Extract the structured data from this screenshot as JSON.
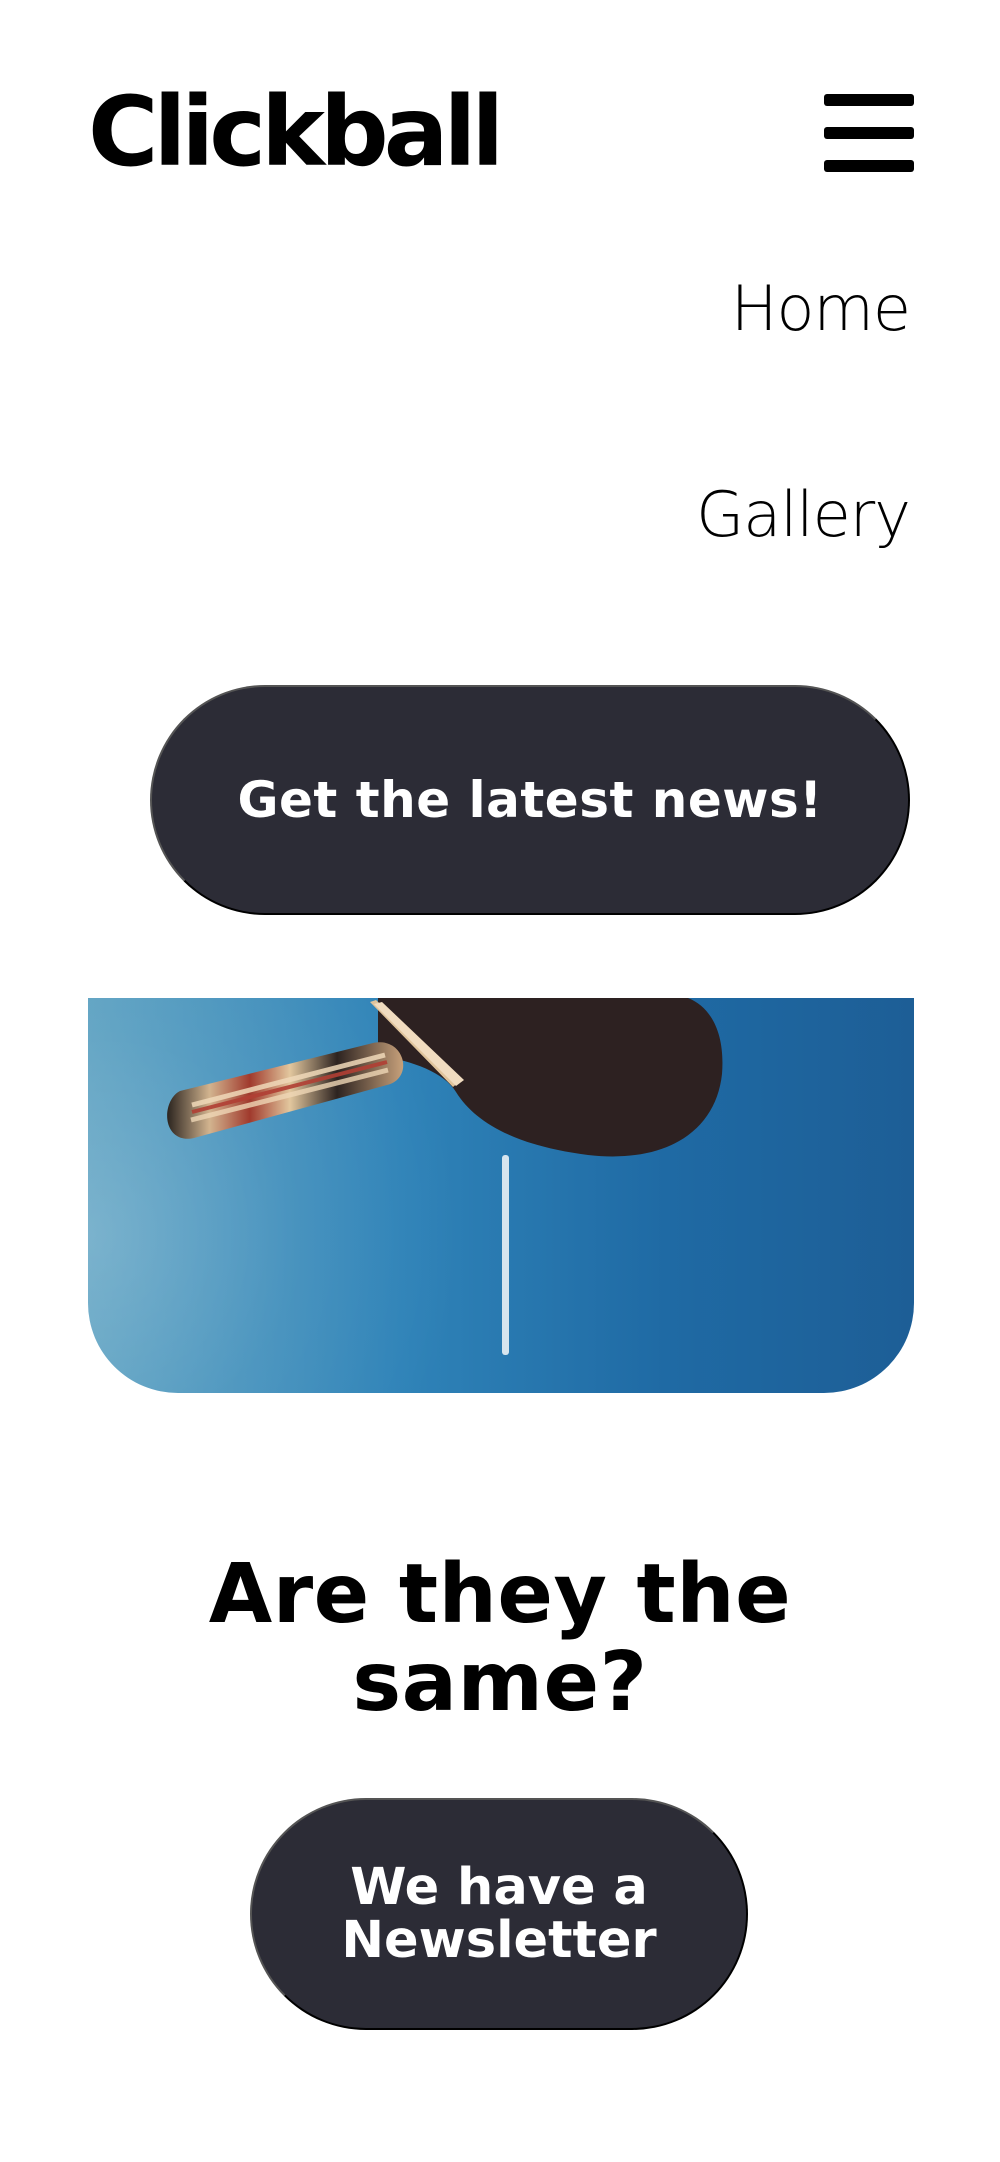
{
  "header": {
    "logo": "Clickball",
    "menu_icon": "hamburger-menu-icon"
  },
  "nav": {
    "items": [
      {
        "label": "Home"
      },
      {
        "label": "Gallery"
      }
    ]
  },
  "hero": {
    "cta_label": "Get the latest news!",
    "image_subject": "table-tennis paddle on blue table"
  },
  "section": {
    "headline": "Are they the same?",
    "cta_label": "We have a Newsletter"
  },
  "colors": {
    "background": "#ffffff",
    "text": "#000000",
    "button": "#2c2c36",
    "button_text": "#ffffff",
    "image_blue": "#2f83b8"
  }
}
